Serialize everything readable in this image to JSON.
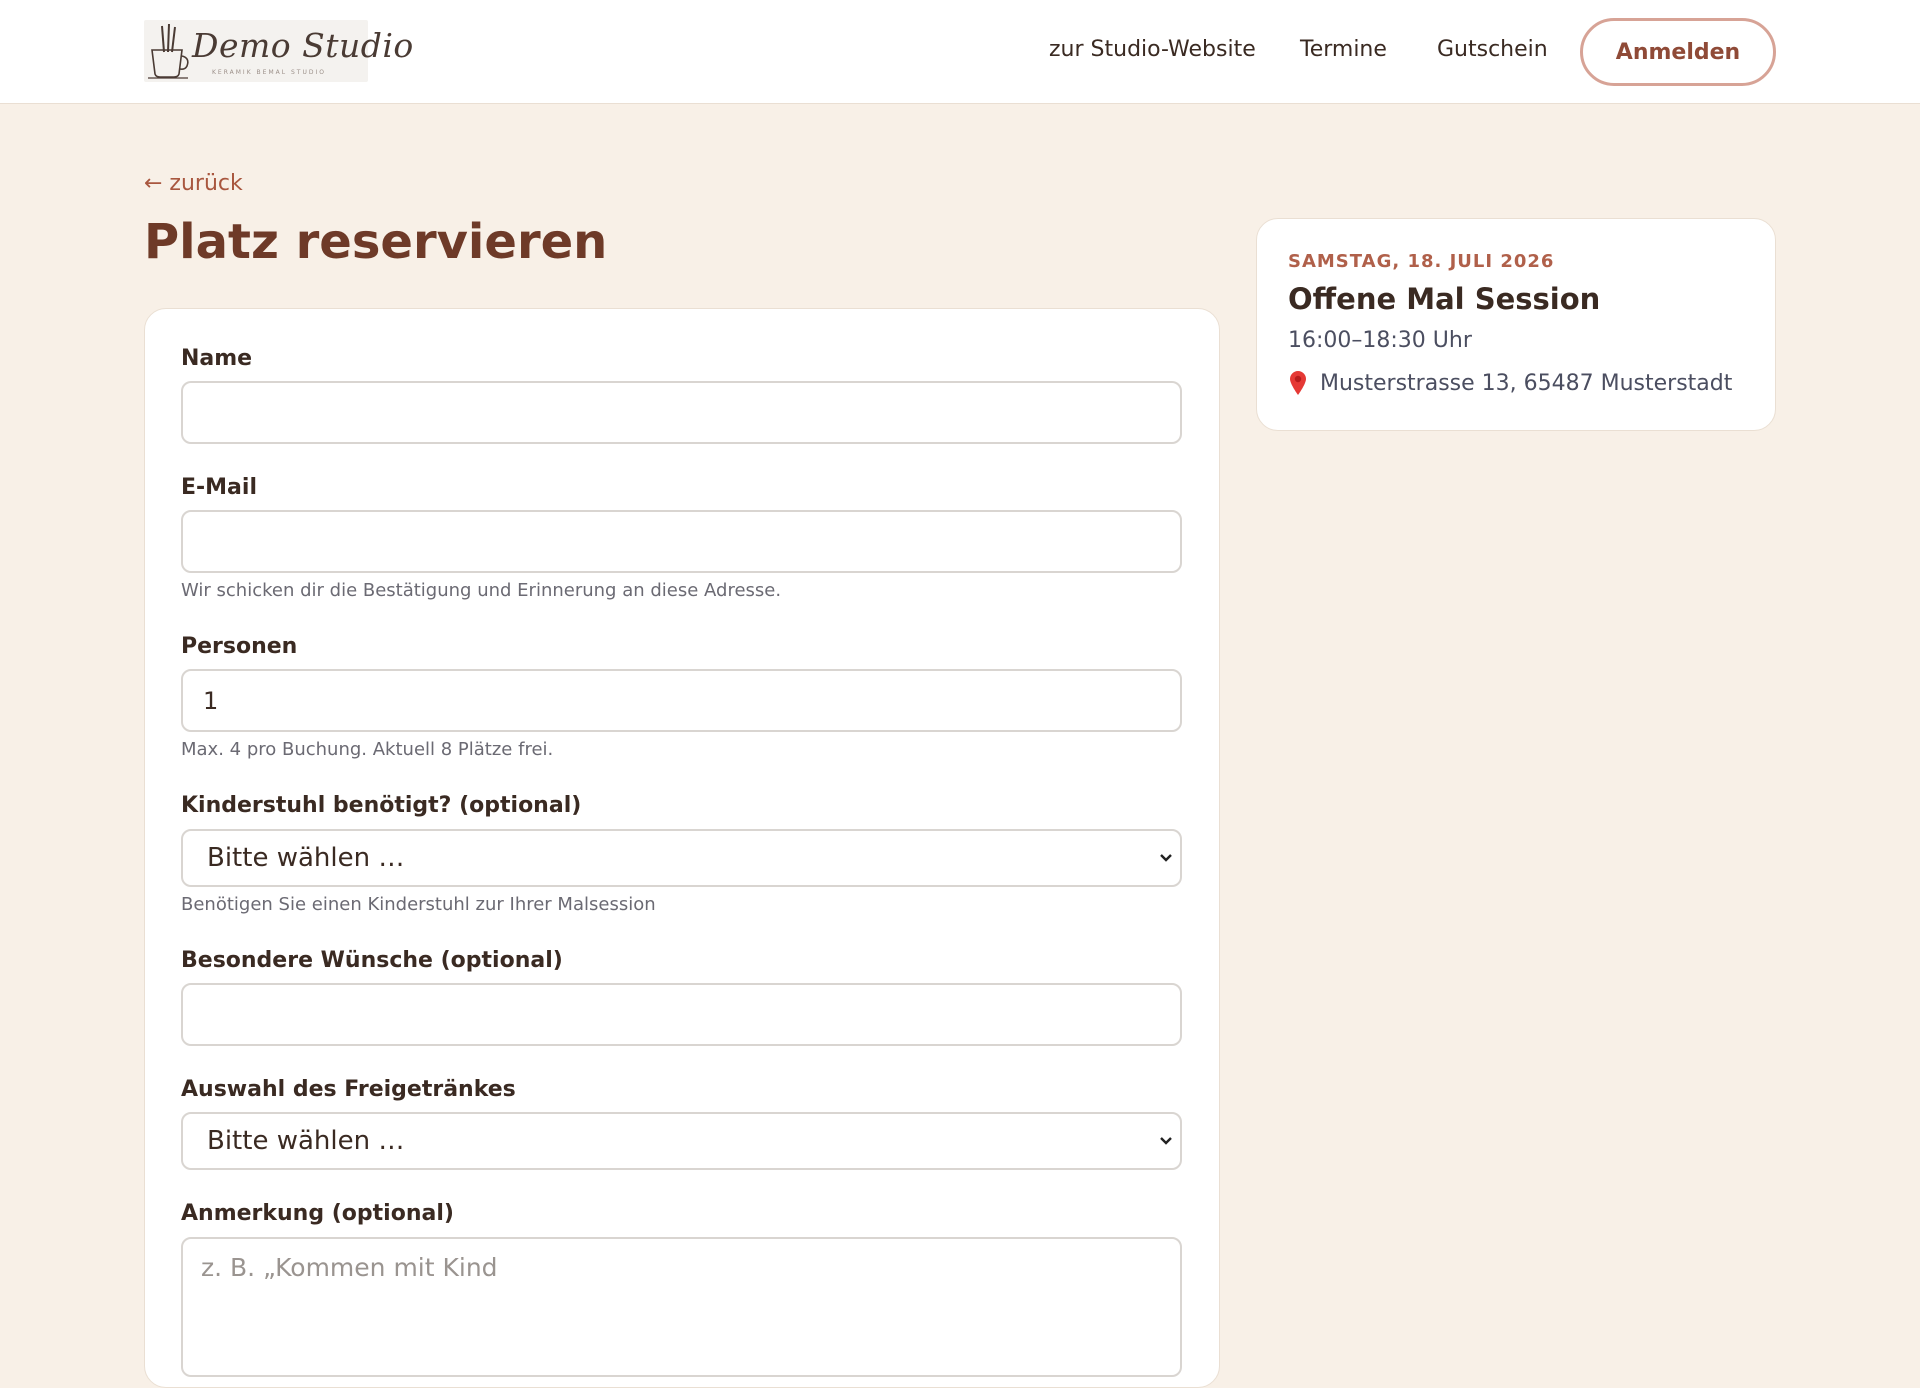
{
  "header": {
    "logo": {
      "wordmark": "Demo Studio",
      "tagline": "KERAMIK BEMAL STUDIO"
    },
    "nav": {
      "studio_website": "zur Studio-Website",
      "termine": "Termine",
      "gutschein": "Gutschein"
    },
    "login_label": "Anmelden"
  },
  "page": {
    "back_link": "← zurück",
    "title": "Platz reservieren"
  },
  "form": {
    "name": {
      "label": "Name",
      "value": ""
    },
    "email": {
      "label": "E-Mail",
      "value": "",
      "hint": "Wir schicken dir die Bestätigung und Erinnerung an diese Adresse."
    },
    "persons": {
      "label": "Personen",
      "value": "1",
      "hint": "Max. 4 pro Buchung. Aktuell 8 Plätze frei."
    },
    "child_chair": {
      "label": "Kinderstuhl benötigt? (optional)",
      "selected": "Bitte wählen …",
      "hint": "Benötigen Sie einen Kinderstuhl zur Ihrer Malsession"
    },
    "wishes": {
      "label": "Besondere Wünsche (optional)",
      "value": ""
    },
    "drinks": {
      "label": "Auswahl des Freigetränkes",
      "selected": "Bitte wählen …"
    },
    "note": {
      "label": "Anmerkung (optional)",
      "placeholder": "z. B. „Kommen mit Kind"
    }
  },
  "event": {
    "date": "SAMSTAG, 18. JULI 2026",
    "title": "Offene Mal Session",
    "time": "16:00–18:30 Uhr",
    "location": "Musterstrasse 13, 65487 Musterstadt"
  },
  "icons": {
    "logo": "cup-brushes-icon",
    "location": "map-pin-icon",
    "select": "chevron-down-icon"
  },
  "colors": {
    "page_background": "#f8f0e7",
    "accent": "#a9573f",
    "title": "#6e3a28",
    "button_border": "#d7a396",
    "location_pin": "#e53935"
  }
}
